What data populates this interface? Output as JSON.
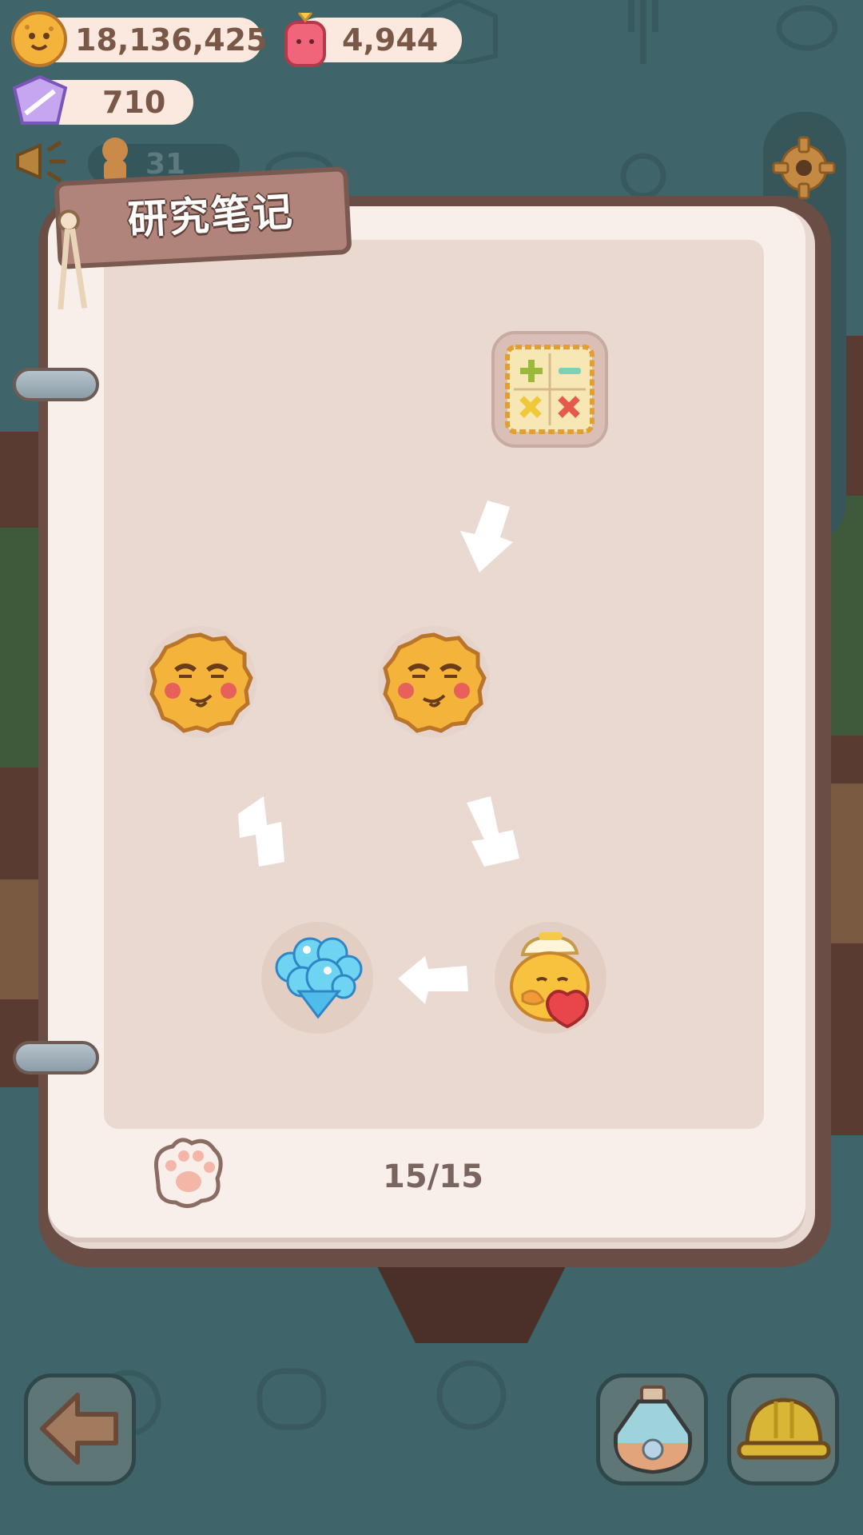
{
  "hud": {
    "cookie_currency": "18,136,425",
    "jam_currency": "4,944",
    "candy_currency": "710",
    "announcement_count": "31"
  },
  "notebook": {
    "title": "研究笔记",
    "page_counter": "15/15"
  },
  "research_chain": [
    {
      "name": "calculator-cookie-item",
      "icon": "calculator-icon"
    },
    {
      "name": "smug-cookie-item",
      "icon": "smug-cookie-icon"
    },
    {
      "name": "smug-cookie-item",
      "icon": "smug-cookie-icon"
    },
    {
      "name": "chick-with-heart-item",
      "icon": "chick-heart-icon"
    },
    {
      "name": "bubble-heart-item",
      "icon": "bubble-heart-icon"
    }
  ],
  "colors": {
    "background": "#3f6469",
    "page": "#f8efeb",
    "page_inner": "#e9d9d1",
    "tag": "#b0847a",
    "book_frame": "#6a4e46"
  }
}
